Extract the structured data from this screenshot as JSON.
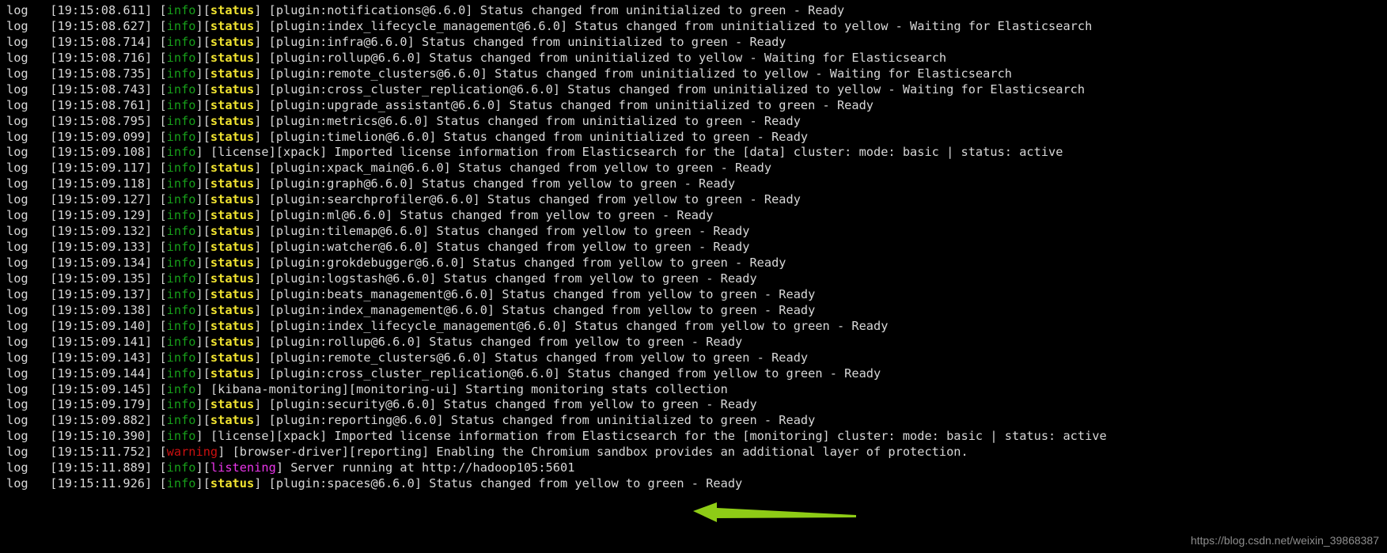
{
  "terminal": {
    "background_color": "#000000",
    "foreground_color": "#d8d8d8",
    "colors": {
      "info": "#17a01a",
      "status": "#f2e530",
      "warning": "#cc1010",
      "listening": "#e935e9",
      "arrow": "#8ecc16"
    },
    "lines": [
      {
        "level": "log",
        "timestamp": "[19:15:08.611]",
        "tags": [
          {
            "text": "[",
            "style": "plain"
          },
          {
            "text": "info",
            "style": "info"
          },
          {
            "text": "][",
            "style": "plain"
          },
          {
            "text": "status",
            "style": "status"
          },
          {
            "text": "]",
            "style": "plain"
          }
        ],
        "message": "[plugin:notifications@6.6.0] Status changed from uninitialized to green - Ready"
      },
      {
        "level": "log",
        "timestamp": "[19:15:08.627]",
        "tags": [
          {
            "text": "[",
            "style": "plain"
          },
          {
            "text": "info",
            "style": "info"
          },
          {
            "text": "][",
            "style": "plain"
          },
          {
            "text": "status",
            "style": "status"
          },
          {
            "text": "]",
            "style": "plain"
          }
        ],
        "message": "[plugin:index_lifecycle_management@6.6.0] Status changed from uninitialized to yellow - Waiting for Elasticsearch"
      },
      {
        "level": "log",
        "timestamp": "[19:15:08.714]",
        "tags": [
          {
            "text": "[",
            "style": "plain"
          },
          {
            "text": "info",
            "style": "info"
          },
          {
            "text": "][",
            "style": "plain"
          },
          {
            "text": "status",
            "style": "status"
          },
          {
            "text": "]",
            "style": "plain"
          }
        ],
        "message": "[plugin:infra@6.6.0] Status changed from uninitialized to green - Ready"
      },
      {
        "level": "log",
        "timestamp": "[19:15:08.716]",
        "tags": [
          {
            "text": "[",
            "style": "plain"
          },
          {
            "text": "info",
            "style": "info"
          },
          {
            "text": "][",
            "style": "plain"
          },
          {
            "text": "status",
            "style": "status"
          },
          {
            "text": "]",
            "style": "plain"
          }
        ],
        "message": "[plugin:rollup@6.6.0] Status changed from uninitialized to yellow - Waiting for Elasticsearch"
      },
      {
        "level": "log",
        "timestamp": "[19:15:08.735]",
        "tags": [
          {
            "text": "[",
            "style": "plain"
          },
          {
            "text": "info",
            "style": "info"
          },
          {
            "text": "][",
            "style": "plain"
          },
          {
            "text": "status",
            "style": "status"
          },
          {
            "text": "]",
            "style": "plain"
          }
        ],
        "message": "[plugin:remote_clusters@6.6.0] Status changed from uninitialized to yellow - Waiting for Elasticsearch"
      },
      {
        "level": "log",
        "timestamp": "[19:15:08.743]",
        "tags": [
          {
            "text": "[",
            "style": "plain"
          },
          {
            "text": "info",
            "style": "info"
          },
          {
            "text": "][",
            "style": "plain"
          },
          {
            "text": "status",
            "style": "status"
          },
          {
            "text": "]",
            "style": "plain"
          }
        ],
        "message": "[plugin:cross_cluster_replication@6.6.0] Status changed from uninitialized to yellow - Waiting for Elasticsearch"
      },
      {
        "level": "log",
        "timestamp": "[19:15:08.761]",
        "tags": [
          {
            "text": "[",
            "style": "plain"
          },
          {
            "text": "info",
            "style": "info"
          },
          {
            "text": "][",
            "style": "plain"
          },
          {
            "text": "status",
            "style": "status"
          },
          {
            "text": "]",
            "style": "plain"
          }
        ],
        "message": "[plugin:upgrade_assistant@6.6.0] Status changed from uninitialized to green - Ready"
      },
      {
        "level": "log",
        "timestamp": "[19:15:08.795]",
        "tags": [
          {
            "text": "[",
            "style": "plain"
          },
          {
            "text": "info",
            "style": "info"
          },
          {
            "text": "][",
            "style": "plain"
          },
          {
            "text": "status",
            "style": "status"
          },
          {
            "text": "]",
            "style": "plain"
          }
        ],
        "message": "[plugin:metrics@6.6.0] Status changed from uninitialized to green - Ready"
      },
      {
        "level": "log",
        "timestamp": "[19:15:09.099]",
        "tags": [
          {
            "text": "[",
            "style": "plain"
          },
          {
            "text": "info",
            "style": "info"
          },
          {
            "text": "][",
            "style": "plain"
          },
          {
            "text": "status",
            "style": "status"
          },
          {
            "text": "]",
            "style": "plain"
          }
        ],
        "message": "[plugin:timelion@6.6.0] Status changed from uninitialized to green - Ready"
      },
      {
        "level": "log",
        "timestamp": "[19:15:09.108]",
        "tags": [
          {
            "text": "[",
            "style": "plain"
          },
          {
            "text": "info",
            "style": "info"
          },
          {
            "text": "]",
            "style": "plain"
          }
        ],
        "message": "[license][xpack] Imported license information from Elasticsearch for the [data] cluster: mode: basic | status: active"
      },
      {
        "level": "log",
        "timestamp": "[19:15:09.117]",
        "tags": [
          {
            "text": "[",
            "style": "plain"
          },
          {
            "text": "info",
            "style": "info"
          },
          {
            "text": "][",
            "style": "plain"
          },
          {
            "text": "status",
            "style": "status"
          },
          {
            "text": "]",
            "style": "plain"
          }
        ],
        "message": "[plugin:xpack_main@6.6.0] Status changed from yellow to green - Ready"
      },
      {
        "level": "log",
        "timestamp": "[19:15:09.118]",
        "tags": [
          {
            "text": "[",
            "style": "plain"
          },
          {
            "text": "info",
            "style": "info"
          },
          {
            "text": "][",
            "style": "plain"
          },
          {
            "text": "status",
            "style": "status"
          },
          {
            "text": "]",
            "style": "plain"
          }
        ],
        "message": "[plugin:graph@6.6.0] Status changed from yellow to green - Ready"
      },
      {
        "level": "log",
        "timestamp": "[19:15:09.127]",
        "tags": [
          {
            "text": "[",
            "style": "plain"
          },
          {
            "text": "info",
            "style": "info"
          },
          {
            "text": "][",
            "style": "plain"
          },
          {
            "text": "status",
            "style": "status"
          },
          {
            "text": "]",
            "style": "plain"
          }
        ],
        "message": "[plugin:searchprofiler@6.6.0] Status changed from yellow to green - Ready"
      },
      {
        "level": "log",
        "timestamp": "[19:15:09.129]",
        "tags": [
          {
            "text": "[",
            "style": "plain"
          },
          {
            "text": "info",
            "style": "info"
          },
          {
            "text": "][",
            "style": "plain"
          },
          {
            "text": "status",
            "style": "status"
          },
          {
            "text": "]",
            "style": "plain"
          }
        ],
        "message": "[plugin:ml@6.6.0] Status changed from yellow to green - Ready"
      },
      {
        "level": "log",
        "timestamp": "[19:15:09.132]",
        "tags": [
          {
            "text": "[",
            "style": "plain"
          },
          {
            "text": "info",
            "style": "info"
          },
          {
            "text": "][",
            "style": "plain"
          },
          {
            "text": "status",
            "style": "status"
          },
          {
            "text": "]",
            "style": "plain"
          }
        ],
        "message": "[plugin:tilemap@6.6.0] Status changed from yellow to green - Ready"
      },
      {
        "level": "log",
        "timestamp": "[19:15:09.133]",
        "tags": [
          {
            "text": "[",
            "style": "plain"
          },
          {
            "text": "info",
            "style": "info"
          },
          {
            "text": "][",
            "style": "plain"
          },
          {
            "text": "status",
            "style": "status"
          },
          {
            "text": "]",
            "style": "plain"
          }
        ],
        "message": "[plugin:watcher@6.6.0] Status changed from yellow to green - Ready"
      },
      {
        "level": "log",
        "timestamp": "[19:15:09.134]",
        "tags": [
          {
            "text": "[",
            "style": "plain"
          },
          {
            "text": "info",
            "style": "info"
          },
          {
            "text": "][",
            "style": "plain"
          },
          {
            "text": "status",
            "style": "status"
          },
          {
            "text": "]",
            "style": "plain"
          }
        ],
        "message": "[plugin:grokdebugger@6.6.0] Status changed from yellow to green - Ready"
      },
      {
        "level": "log",
        "timestamp": "[19:15:09.135]",
        "tags": [
          {
            "text": "[",
            "style": "plain"
          },
          {
            "text": "info",
            "style": "info"
          },
          {
            "text": "][",
            "style": "plain"
          },
          {
            "text": "status",
            "style": "status"
          },
          {
            "text": "]",
            "style": "plain"
          }
        ],
        "message": "[plugin:logstash@6.6.0] Status changed from yellow to green - Ready"
      },
      {
        "level": "log",
        "timestamp": "[19:15:09.137]",
        "tags": [
          {
            "text": "[",
            "style": "plain"
          },
          {
            "text": "info",
            "style": "info"
          },
          {
            "text": "][",
            "style": "plain"
          },
          {
            "text": "status",
            "style": "status"
          },
          {
            "text": "]",
            "style": "plain"
          }
        ],
        "message": "[plugin:beats_management@6.6.0] Status changed from yellow to green - Ready"
      },
      {
        "level": "log",
        "timestamp": "[19:15:09.138]",
        "tags": [
          {
            "text": "[",
            "style": "plain"
          },
          {
            "text": "info",
            "style": "info"
          },
          {
            "text": "][",
            "style": "plain"
          },
          {
            "text": "status",
            "style": "status"
          },
          {
            "text": "]",
            "style": "plain"
          }
        ],
        "message": "[plugin:index_management@6.6.0] Status changed from yellow to green - Ready"
      },
      {
        "level": "log",
        "timestamp": "[19:15:09.140]",
        "tags": [
          {
            "text": "[",
            "style": "plain"
          },
          {
            "text": "info",
            "style": "info"
          },
          {
            "text": "][",
            "style": "plain"
          },
          {
            "text": "status",
            "style": "status"
          },
          {
            "text": "]",
            "style": "plain"
          }
        ],
        "message": "[plugin:index_lifecycle_management@6.6.0] Status changed from yellow to green - Ready"
      },
      {
        "level": "log",
        "timestamp": "[19:15:09.141]",
        "tags": [
          {
            "text": "[",
            "style": "plain"
          },
          {
            "text": "info",
            "style": "info"
          },
          {
            "text": "][",
            "style": "plain"
          },
          {
            "text": "status",
            "style": "status"
          },
          {
            "text": "]",
            "style": "plain"
          }
        ],
        "message": "[plugin:rollup@6.6.0] Status changed from yellow to green - Ready"
      },
      {
        "level": "log",
        "timestamp": "[19:15:09.143]",
        "tags": [
          {
            "text": "[",
            "style": "plain"
          },
          {
            "text": "info",
            "style": "info"
          },
          {
            "text": "][",
            "style": "plain"
          },
          {
            "text": "status",
            "style": "status"
          },
          {
            "text": "]",
            "style": "plain"
          }
        ],
        "message": "[plugin:remote_clusters@6.6.0] Status changed from yellow to green - Ready"
      },
      {
        "level": "log",
        "timestamp": "[19:15:09.144]",
        "tags": [
          {
            "text": "[",
            "style": "plain"
          },
          {
            "text": "info",
            "style": "info"
          },
          {
            "text": "][",
            "style": "plain"
          },
          {
            "text": "status",
            "style": "status"
          },
          {
            "text": "]",
            "style": "plain"
          }
        ],
        "message": "[plugin:cross_cluster_replication@6.6.0] Status changed from yellow to green - Ready"
      },
      {
        "level": "log",
        "timestamp": "[19:15:09.145]",
        "tags": [
          {
            "text": "[",
            "style": "plain"
          },
          {
            "text": "info",
            "style": "info"
          },
          {
            "text": "]",
            "style": "plain"
          }
        ],
        "message": "[kibana-monitoring][monitoring-ui] Starting monitoring stats collection"
      },
      {
        "level": "log",
        "timestamp": "[19:15:09.179]",
        "tags": [
          {
            "text": "[",
            "style": "plain"
          },
          {
            "text": "info",
            "style": "info"
          },
          {
            "text": "][",
            "style": "plain"
          },
          {
            "text": "status",
            "style": "status"
          },
          {
            "text": "]",
            "style": "plain"
          }
        ],
        "message": "[plugin:security@6.6.0] Status changed from yellow to green - Ready"
      },
      {
        "level": "log",
        "timestamp": "[19:15:09.882]",
        "tags": [
          {
            "text": "[",
            "style": "plain"
          },
          {
            "text": "info",
            "style": "info"
          },
          {
            "text": "][",
            "style": "plain"
          },
          {
            "text": "status",
            "style": "status"
          },
          {
            "text": "]",
            "style": "plain"
          }
        ],
        "message": "[plugin:reporting@6.6.0] Status changed from uninitialized to green - Ready"
      },
      {
        "level": "log",
        "timestamp": "[19:15:10.390]",
        "tags": [
          {
            "text": "[",
            "style": "plain"
          },
          {
            "text": "info",
            "style": "info"
          },
          {
            "text": "]",
            "style": "plain"
          }
        ],
        "message": "[license][xpack] Imported license information from Elasticsearch for the [monitoring] cluster: mode: basic | status: active"
      },
      {
        "level": "log",
        "timestamp": "[19:15:11.752]",
        "tags": [
          {
            "text": "[",
            "style": "plain"
          },
          {
            "text": "warning",
            "style": "warning"
          },
          {
            "text": "]",
            "style": "plain"
          }
        ],
        "message": "[browser-driver][reporting] Enabling the Chromium sandbox provides an additional layer of protection."
      },
      {
        "level": "log",
        "timestamp": "[19:15:11.889]",
        "tags": [
          {
            "text": "[",
            "style": "plain"
          },
          {
            "text": "info",
            "style": "info"
          },
          {
            "text": "][",
            "style": "plain"
          },
          {
            "text": "listening",
            "style": "listening"
          },
          {
            "text": "]",
            "style": "plain"
          }
        ],
        "message": "Server running at http://hadoop105:5601"
      },
      {
        "level": "log",
        "timestamp": "[19:15:11.926]",
        "tags": [
          {
            "text": "[",
            "style": "plain"
          },
          {
            "text": "info",
            "style": "info"
          },
          {
            "text": "][",
            "style": "plain"
          },
          {
            "text": "status",
            "style": "status"
          },
          {
            "text": "]",
            "style": "plain"
          }
        ],
        "message": "[plugin:spaces@6.6.0] Status changed from yellow to green - Ready"
      }
    ]
  },
  "annotation": {
    "arrow_color": "#8ecc16",
    "points_to": "Server running at http://hadoop105:5601"
  },
  "watermark": {
    "text": "https://blog.csdn.net/weixin_39868387"
  }
}
